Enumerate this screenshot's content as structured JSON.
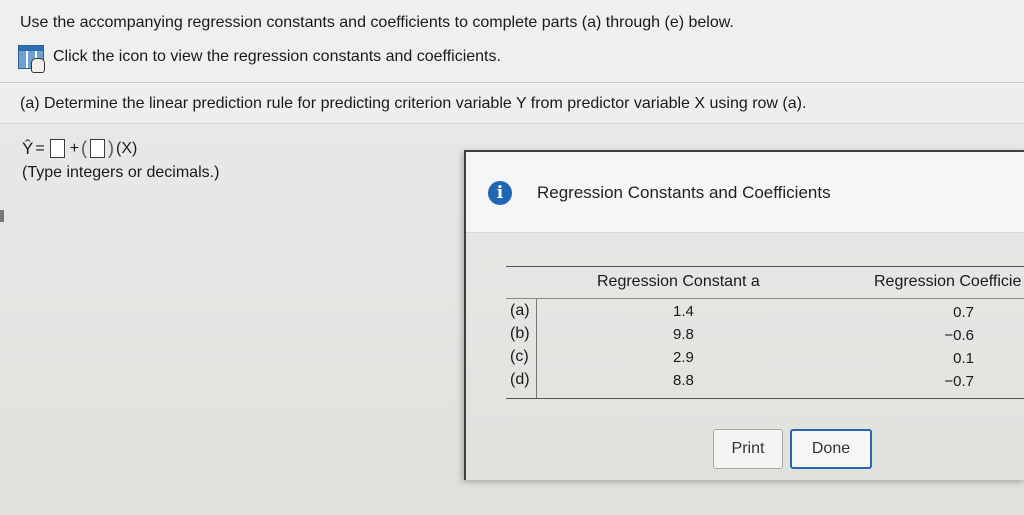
{
  "header": {
    "instructions": "Use the accompanying regression constants and coefficients to complete parts (a) through (e) below.",
    "help_text": "Click the icon to view the regression constants and coefficients."
  },
  "part_a": {
    "prompt": "(a) Determine the linear prediction rule for predicting criterion variable Y from predictor variable X using row (a).",
    "yhat": "Ŷ",
    "equals": "=",
    "plus": "+",
    "open_paren": "(",
    "close_paren": ")",
    "x_term": "(X)",
    "constant_value": "",
    "coefficient_value": "",
    "hint": "(Type integers or decimals.)"
  },
  "dialog": {
    "title": "Regression Constants and Coefficients",
    "info_icon": "i",
    "table": {
      "headers": [
        "Regression Constant a",
        "Regression Coefficie"
      ],
      "rows": [
        {
          "label": "(a)",
          "constant": "1.4",
          "coefficient": "0.7"
        },
        {
          "label": "(b)",
          "constant": "9.8",
          "coefficient": "−0.6"
        },
        {
          "label": "(c)",
          "constant": "2.9",
          "coefficient": "0.1"
        },
        {
          "label": "(d)",
          "constant": "8.8",
          "coefficient": "−0.7"
        }
      ]
    },
    "print_label": "Print",
    "done_label": "Done"
  },
  "colors": {
    "accent": "#2b64b0",
    "info_icon": "#1f66b5"
  }
}
